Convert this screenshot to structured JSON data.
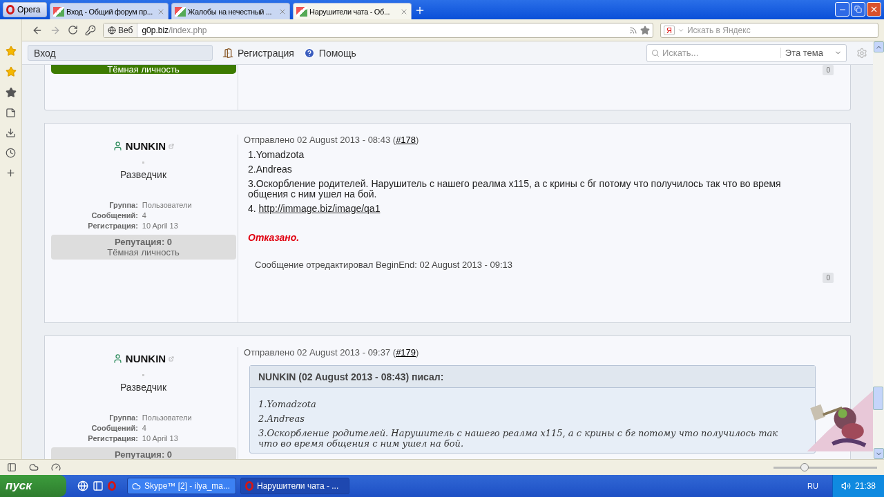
{
  "browser": {
    "menu_button": "Opera",
    "tabs": [
      {
        "label": "Вход - Общий форум пр...",
        "selected": false
      },
      {
        "label": "Жалобы на нечестный ...",
        "selected": false
      },
      {
        "label": "Нарушители чата - Об...",
        "selected": true
      }
    ],
    "address": {
      "badge": "Веб",
      "host": "g0p.biz",
      "path": "/index.php"
    },
    "search": {
      "engine": "Я",
      "placeholder": "Искать в Яндекс"
    }
  },
  "forum_nav": {
    "login": "Вход",
    "links": [
      "Регистрация",
      "Помощь"
    ],
    "search_placeholder": "Искать...",
    "scope": "Эта тема"
  },
  "partial_post": {
    "rank_bar": "Тёмная личность",
    "likes": "0"
  },
  "posts": [
    {
      "author": "NUNKIN",
      "rank": "Разведчик",
      "fields": [
        {
          "label": "Группа:",
          "value": "Пользователи"
        },
        {
          "label": "Сообщений:",
          "value": "4"
        },
        {
          "label": "Регистрация:",
          "value": "10 April 13"
        }
      ],
      "reputation": "Репутация: 0",
      "reputation_title": "Тёмная личность",
      "posted": "Отправлено 02 August 2013 - 08:43 (",
      "post_link": "#178",
      "posted_end": ")",
      "body": [
        {
          "kind": "line",
          "text": "1.Yomadzota"
        },
        {
          "kind": "line",
          "text": "2.Andreas"
        },
        {
          "kind": "line",
          "text": "3.Оскорбление родителей. Нарушитель с нашего реалма x115, а с крины с бг потому что получилось так что во время общения с ним ушел на бой."
        },
        {
          "kind": "link",
          "prefix": "4. ",
          "text": "http://immage.biz/image/qa1"
        },
        {
          "kind": "verdict",
          "text": "Отказано."
        }
      ],
      "edited": "Сообщение отредактировал BeginEnd: 02 August 2013 - 09:13",
      "likes": "0"
    },
    {
      "author": "NUNKIN",
      "rank": "Разведчик",
      "fields": [
        {
          "label": "Группа:",
          "value": "Пользователи"
        },
        {
          "label": "Сообщений:",
          "value": "4"
        },
        {
          "label": "Регистрация:",
          "value": "10 April 13"
        }
      ],
      "reputation": "Репутация: 0",
      "posted": "Отправлено 02 August 2013 - 09:37 (",
      "post_link": "#179",
      "posted_end": ")",
      "body": [
        {
          "kind": "quote",
          "header": "NUNKIN (02 August 2013 - 08:43) писал:",
          "lines": [
            "1.Yomadzota",
            "2.Andreas",
            "3.Оскорбление родителей. Нарушитель с нашего реалма x115, а с крины с бг потому что получилось так что во время общения с ним ушел на бой."
          ]
        }
      ]
    }
  ],
  "status_bar": {
    "zoom": {
      "level": 0.3
    }
  },
  "taskbar": {
    "start": "пуск",
    "windows": [
      {
        "label": "Skype™ [2] - ilya_ma...",
        "selected": false
      },
      {
        "label": "Нарушители чата - ...",
        "selected": true
      }
    ],
    "language": "RU",
    "clock": "21:38"
  }
}
